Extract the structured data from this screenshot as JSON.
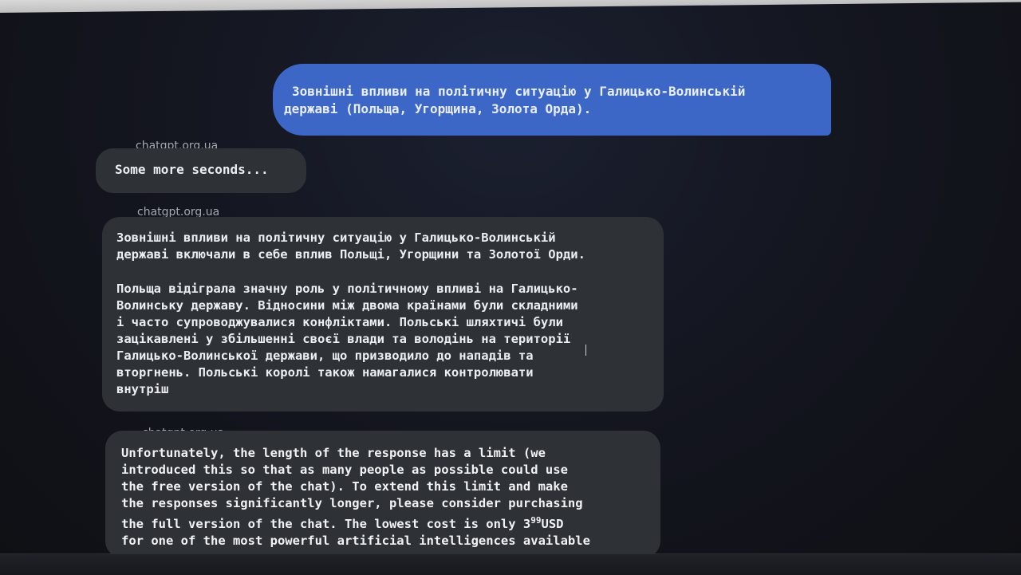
{
  "source_label": "chatgpt.org.ua",
  "user_message": {
    "line1": "Зовнішні впливи на політичну ситуацію у Галицько-Волинській",
    "line2": "державі (Польща, Угорщина, Золота Орда)."
  },
  "loading_message": "Some more seconds...",
  "answer": {
    "paragraph1": [
      "Зовнішні впливи на політичну ситуацію у Галицько-Волинській",
      "державі включали в себе вплив Польщі, Угорщини та Золотої Орди."
    ],
    "paragraph2": [
      "Польща відіграла значну роль у політичному впливі на Галицько-",
      "Волинську державу. Відносини між двома країнами були складними",
      "і часто супроводжувалися конфліктами. Польські шляхтичі були",
      "зацікавлені у збільшенні своєї влади та володінь на території",
      "Галицько-Волинської держави, що призводило до нападів та",
      "вторгнень. Польські королі також намагалися контролювати",
      "внутріш"
    ]
  },
  "limit_notice": {
    "lines": [
      "Unfortunately, the length of the response has a limit (we",
      "introduced this so that as many people as possible could use",
      "the free version of the chat). To extend this limit and make",
      "the responses significantly longer, please consider purchasing"
    ],
    "price_prefix": "the full version of the chat. The lowest cost is only 3",
    "price_cents": "99",
    "price_currency": "USD",
    "last_line": "for one of the most powerful artificial intelligences available"
  }
}
